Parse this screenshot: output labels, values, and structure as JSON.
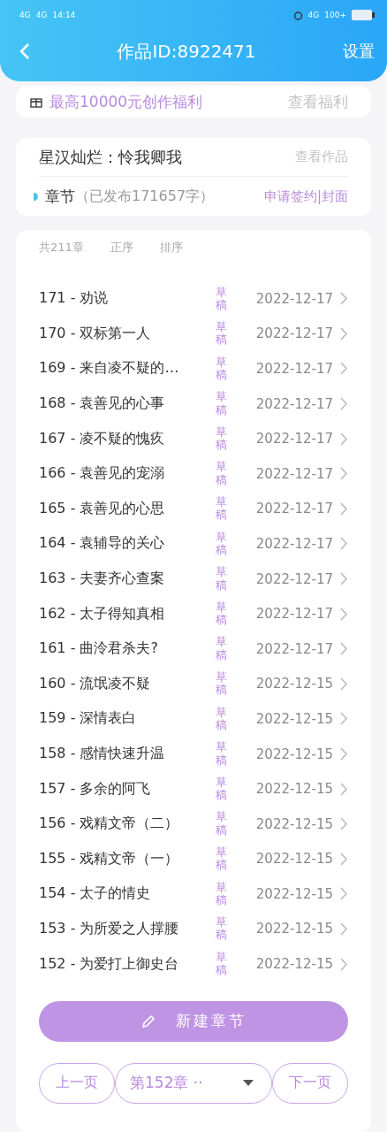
{
  "status_bar": {
    "network_1": "4G",
    "network_2": "4G",
    "time": "14:14",
    "network_3": "4G",
    "battery": "100+"
  },
  "header": {
    "title": "作品ID:8922471",
    "action": "设置"
  },
  "benefit": {
    "text": "最高10000元创作福利",
    "link": "查看福利"
  },
  "work": {
    "title": "星汉灿烂：怜我卿我",
    "link": "查看作品",
    "section": "章节",
    "published": "（已发布171657字）",
    "actions": "申请签约|封面"
  },
  "list": {
    "count": "共211章",
    "order": "正序",
    "sort": "排序"
  },
  "chapters": [
    {
      "title": "171 - 劝说",
      "status": "草稿",
      "date": "2022-12-17"
    },
    {
      "title": "170 - 双标第一人",
      "status": "草稿",
      "date": "2022-12-17"
    },
    {
      "title": "169 - 来自凌不疑的…",
      "status": "草稿",
      "date": "2022-12-17"
    },
    {
      "title": "168 - 袁善见的心事",
      "status": "草稿",
      "date": "2022-12-17"
    },
    {
      "title": "167 - 凌不疑的愧疚",
      "status": "草稿",
      "date": "2022-12-17"
    },
    {
      "title": "166 - 袁善见的宠溺",
      "status": "草稿",
      "date": "2022-12-17"
    },
    {
      "title": "165 - 袁善见的心思",
      "status": "草稿",
      "date": "2022-12-17"
    },
    {
      "title": "164 - 袁辅导的关心",
      "status": "草稿",
      "date": "2022-12-17"
    },
    {
      "title": "163 - 夫妻齐心查案",
      "status": "草稿",
      "date": "2022-12-17"
    },
    {
      "title": "162 - 太子得知真相",
      "status": "草稿",
      "date": "2022-12-17"
    },
    {
      "title": "161 - 曲泠君杀夫?",
      "status": "草稿",
      "date": "2022-12-17"
    },
    {
      "title": "160 - 流氓凌不疑",
      "status": "草稿",
      "date": "2022-12-15"
    },
    {
      "title": "159 - 深情表白",
      "status": "草稿",
      "date": "2022-12-15"
    },
    {
      "title": "158 - 感情快速升温",
      "status": "草稿",
      "date": "2022-12-15"
    },
    {
      "title": "157 - 多余的阿飞",
      "status": "草稿",
      "date": "2022-12-15"
    },
    {
      "title": "156 - 戏精文帝（二）",
      "status": "草稿",
      "date": "2022-12-15"
    },
    {
      "title": "155 - 戏精文帝（一）",
      "status": "草稿",
      "date": "2022-12-15"
    },
    {
      "title": "154 - 太子的情史",
      "status": "草稿",
      "date": "2022-12-15"
    },
    {
      "title": "153 - 为所爱之人撑腰",
      "status": "草稿",
      "date": "2022-12-15"
    },
    {
      "title": "152 - 为爱打上御史台",
      "status": "草稿",
      "date": "2022-12-15"
    }
  ],
  "new_chapter_button": "新建章节",
  "pager": {
    "prev": "上一页",
    "current": "第152章 ··",
    "next": "下一页"
  }
}
